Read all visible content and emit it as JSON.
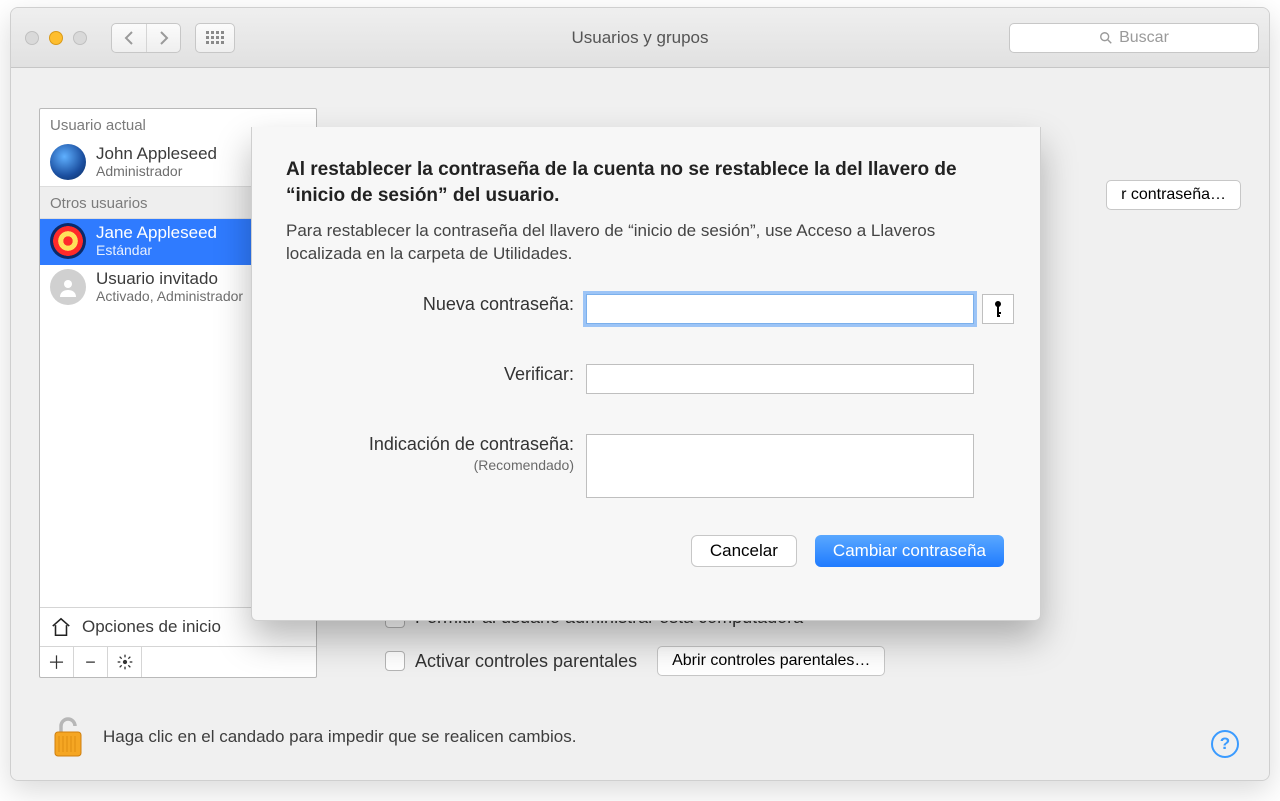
{
  "window": {
    "title": "Usuarios y grupos",
    "search_placeholder": "Buscar"
  },
  "sidebar": {
    "current_header": "Usuario actual",
    "others_header": "Otros usuarios",
    "current": {
      "name": "John Appleseed",
      "role": "Administrador"
    },
    "others": [
      {
        "name": "Jane Appleseed",
        "role": "Estándar"
      },
      {
        "name": "Usuario invitado",
        "role": "Activado, Administrador"
      }
    ],
    "login_options_label": "Opciones de inicio"
  },
  "rightpane": {
    "reset_password_button": "Restablecer contraseña…",
    "reset_password_button_tail": "r contraseña…",
    "checkbox_admin": "Permitir al usuario administrar esta computadora",
    "checkbox_parental": "Activar controles parentales",
    "open_parental_button": "Abrir controles parentales…"
  },
  "lock": {
    "text": "Haga clic en el candado para impedir que se realicen cambios."
  },
  "dialog": {
    "heading": "Al restablecer la contraseña de la cuenta no se restablece la del llavero de “inicio de sesión” del usuario.",
    "description": "Para restablecer la contraseña del llavero de “inicio de sesión”, use Acceso a Llaveros localizada en la carpeta de Utilidades.",
    "labels": {
      "new_password": "Nueva contraseña:",
      "verify": "Verificar:",
      "hint": "Indicación de contraseña:",
      "hint_rec": "(Recomendado)"
    },
    "buttons": {
      "cancel": "Cancelar",
      "change": "Cambiar contraseña"
    },
    "values": {
      "new_password": "",
      "verify": "",
      "hint": ""
    }
  }
}
